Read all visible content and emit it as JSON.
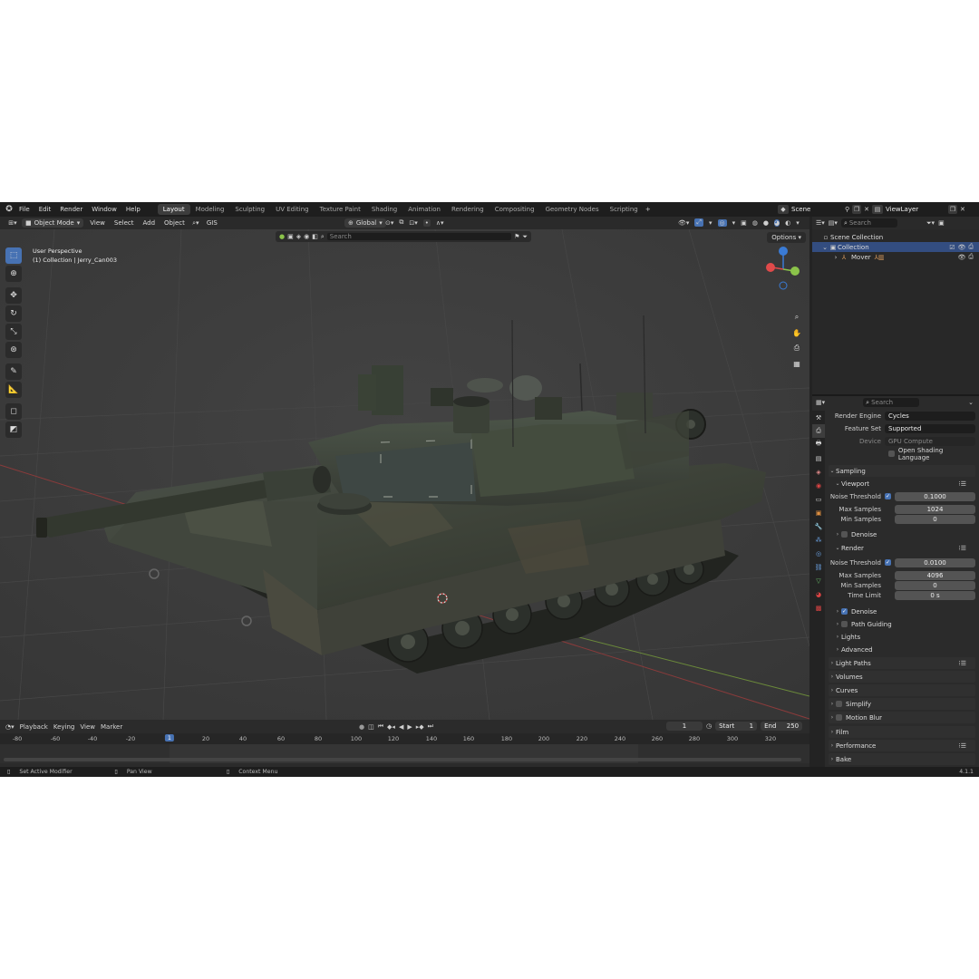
{
  "topbar": {
    "menus": [
      "File",
      "Edit",
      "Render",
      "Window",
      "Help"
    ],
    "workspaces": [
      "Layout",
      "Modeling",
      "Sculpting",
      "UV Editing",
      "Texture Paint",
      "Shading",
      "Animation",
      "Rendering",
      "Compositing",
      "Geometry Nodes",
      "Scripting"
    ],
    "active_workspace": "Layout",
    "scene": "Scene",
    "view_layer": "ViewLayer"
  },
  "header": {
    "mode": "Object Mode",
    "menus": [
      "View",
      "Select",
      "Add",
      "Object"
    ],
    "gis": "GIS",
    "transform_orientation": "Global"
  },
  "viewport": {
    "view_name": "User Perspective",
    "collection_info": "(1) Collection | Jerry_Can003",
    "search_placeholder": "Search",
    "options_label": "Options"
  },
  "outliner": {
    "search_placeholder": "Search",
    "scene_collection": "Scene Collection",
    "collection": "Collection",
    "object": "Mover"
  },
  "properties": {
    "search_placeholder": "Search",
    "render_engine_label": "Render Engine",
    "render_engine": "Cycles",
    "feature_set_label": "Feature Set",
    "feature_set": "Supported",
    "device_label": "Device",
    "device": "GPU Compute",
    "osl_label": "Open Shading Language",
    "sampling": "Sampling",
    "viewport_sub": "Viewport",
    "noise_threshold_label": "Noise Threshold",
    "vp_noise_threshold": "0.1000",
    "max_samples_label": "Max Samples",
    "vp_max_samples": "1024",
    "min_samples_label": "Min Samples",
    "vp_min_samples": "0",
    "denoise_label": "Denoise",
    "render_sub": "Render",
    "r_noise_threshold": "0.0100",
    "r_max_samples": "4096",
    "r_min_samples": "0",
    "time_limit_label": "Time Limit",
    "time_limit": "0 s",
    "path_guiding": "Path Guiding",
    "lights": "Lights",
    "advanced": "Advanced",
    "light_paths": "Light Paths",
    "volumes": "Volumes",
    "curves": "Curves",
    "simplify": "Simplify",
    "motion_blur": "Motion Blur",
    "film": "Film",
    "performance": "Performance",
    "bake": "Bake"
  },
  "timeline": {
    "menus": [
      "Playback",
      "Keying",
      "View",
      "Marker"
    ],
    "current_frame": "1",
    "start_label": "Start",
    "start": "1",
    "end_label": "End",
    "end": "250",
    "ticks": [
      "-80",
      "-60",
      "-40",
      "-20",
      "1",
      "20",
      "40",
      "60",
      "80",
      "100",
      "120",
      "140",
      "160",
      "180",
      "200",
      "220",
      "240",
      "260",
      "280",
      "300",
      "320"
    ]
  },
  "status": {
    "left": "Set Active Modifier",
    "middle": "Pan View",
    "right": "Context Menu",
    "version": "4.1.1"
  }
}
